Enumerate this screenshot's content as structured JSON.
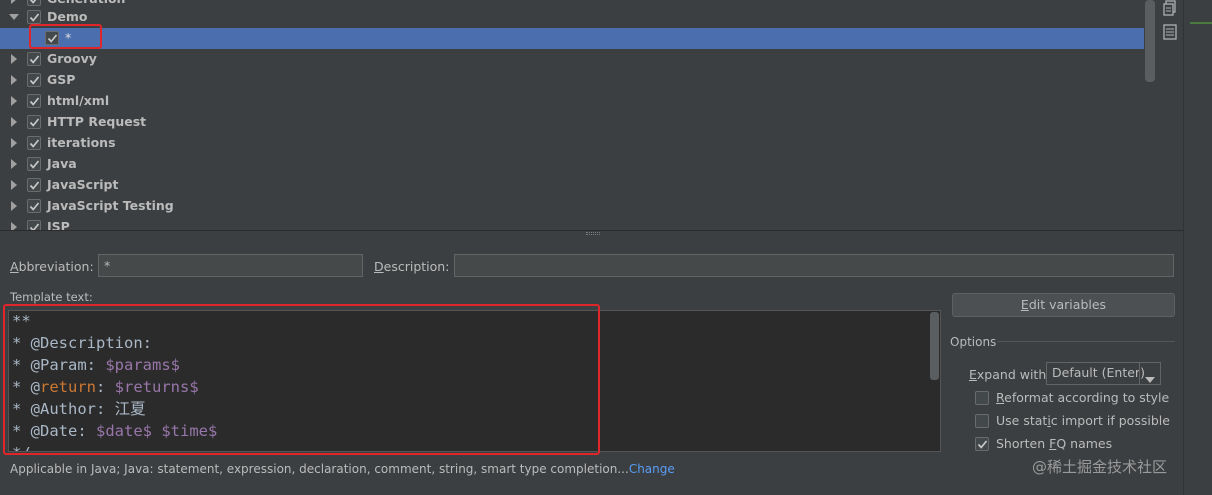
{
  "tree": {
    "items": [
      {
        "label": "Generation",
        "state": "collapsed",
        "checked": true
      },
      {
        "label": "Demo",
        "state": "expanded",
        "checked": true
      },
      {
        "label": "*",
        "state": "child",
        "checked": true,
        "selected": true
      },
      {
        "label": "Groovy",
        "state": "collapsed",
        "checked": true
      },
      {
        "label": "GSP",
        "state": "collapsed",
        "checked": true
      },
      {
        "label": "html/xml",
        "state": "collapsed",
        "checked": true
      },
      {
        "label": "HTTP Request",
        "state": "collapsed",
        "checked": true
      },
      {
        "label": "iterations",
        "state": "collapsed",
        "checked": true
      },
      {
        "label": "Java",
        "state": "collapsed",
        "checked": true
      },
      {
        "label": "JavaScript",
        "state": "collapsed",
        "checked": true
      },
      {
        "label": "JavaScript Testing",
        "state": "collapsed",
        "checked": true
      },
      {
        "label": "JSP",
        "state": "collapsed",
        "checked": true
      }
    ]
  },
  "toolbar": {
    "icons": [
      "copy-icon",
      "description-icon"
    ]
  },
  "form": {
    "abbreviation_label": "Abbreviation:",
    "abbreviation_value": "*",
    "description_label": "Description:",
    "description_value": "",
    "template_text_label": "Template text:"
  },
  "template": {
    "lines": [
      [
        {
          "t": "**",
          "c": "plain"
        }
      ],
      [
        {
          "t": "* @Description:",
          "c": "plain"
        }
      ],
      [
        {
          "t": "* @Param: ",
          "c": "plain"
        },
        {
          "t": "$params$",
          "c": "var"
        }
      ],
      [
        {
          "t": "* @",
          "c": "plain"
        },
        {
          "t": "return",
          "c": "ret"
        },
        {
          "t": ": ",
          "c": "plain"
        },
        {
          "t": "$returns$",
          "c": "var"
        }
      ],
      [
        {
          "t": "* @Author: 江夏",
          "c": "plain"
        }
      ],
      [
        {
          "t": "* @Date: ",
          "c": "plain"
        },
        {
          "t": "$date$",
          "c": "var"
        },
        {
          "t": " ",
          "c": "plain"
        },
        {
          "t": "$time$",
          "c": "var"
        }
      ],
      [
        {
          "t": "*/",
          "c": "plain"
        }
      ]
    ]
  },
  "buttons": {
    "edit_variables": "Edit variables"
  },
  "options": {
    "title": "Options",
    "expand_with_label": "Expand with",
    "expand_with_value": "Default (Enter)",
    "checkboxes": [
      {
        "label": "Reformat according to style",
        "checked": false
      },
      {
        "label": "Use static import if possible",
        "checked": false
      },
      {
        "label": "Shorten FQ names",
        "checked": true
      }
    ]
  },
  "applicable": {
    "text": "Applicable in Java; Java: statement, expression, declaration, comment, string, smart type completion...",
    "change_link": "Change"
  },
  "watermark": "@稀土掘金技术社区",
  "colors": {
    "selection": "#4b6eaf",
    "annotation_box": "#e0262a",
    "link": "#589df6",
    "template_variable": "#9876aa",
    "keyword": "#cc7832"
  }
}
